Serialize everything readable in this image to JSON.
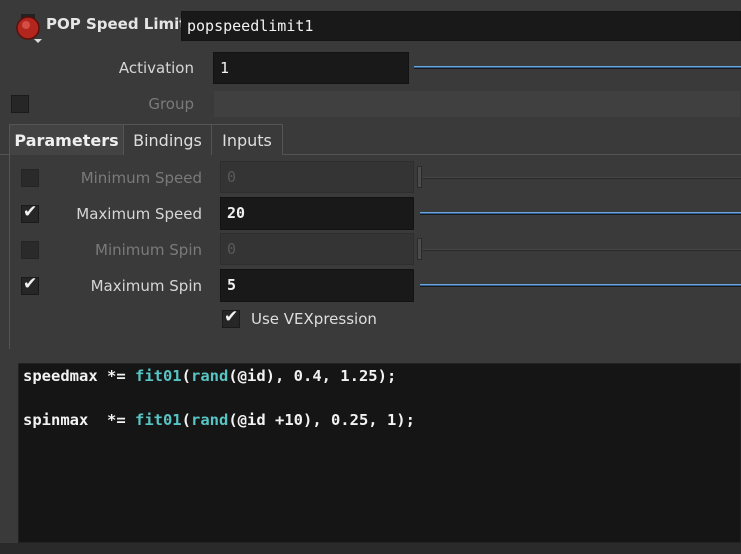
{
  "header": {
    "node_type": "POP Speed Limit",
    "node_name": "popspeedlimit1",
    "icon": "stop-sign-icon"
  },
  "activation": {
    "label": "Activation",
    "value": "1"
  },
  "group": {
    "label": "Group",
    "value": ""
  },
  "tabs": [
    {
      "label": "Parameters",
      "active": true
    },
    {
      "label": "Bindings",
      "active": false
    },
    {
      "label": "Inputs",
      "active": false
    }
  ],
  "params": {
    "min_speed": {
      "label": "Minimum Speed",
      "value": "0",
      "enabled": false
    },
    "max_speed": {
      "label": "Maximum Speed",
      "value": "20",
      "enabled": true
    },
    "min_spin": {
      "label": "Minimum Spin",
      "value": "0",
      "enabled": false
    },
    "max_spin": {
      "label": "Maximum Spin",
      "value": "5",
      "enabled": true
    },
    "use_vex": {
      "label": "Use VEXpression",
      "checked": true
    }
  },
  "code": {
    "line1": {
      "var": "speedmax *= ",
      "fn1": "fit01",
      "p1": "(",
      "fn2": "rand",
      "rest": "(@id), 0.4, 1.25);"
    },
    "line2": {
      "var": "spinmax  *= ",
      "fn1": "fit01",
      "p1": "(",
      "fn2": "rand",
      "rest": "(@id +10), 0.25, 1);"
    }
  },
  "colors": {
    "function": "#58c4c4",
    "slider": "#2f5d8c",
    "background": "#3a3a3a"
  }
}
